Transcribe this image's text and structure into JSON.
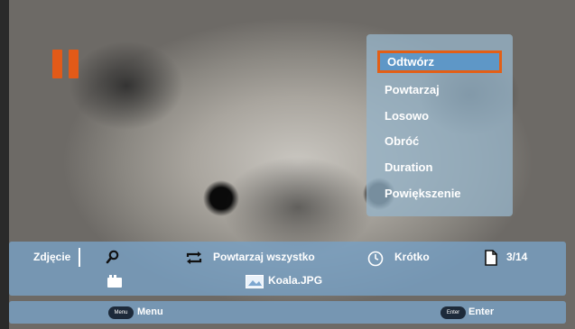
{
  "playback": {
    "state_icon": "pause-icon"
  },
  "menu": {
    "items": [
      {
        "label": "Odtwórz",
        "selected": true
      },
      {
        "label": "Powtarzaj",
        "selected": false
      },
      {
        "label": "Losowo",
        "selected": false
      },
      {
        "label": "Obróć",
        "selected": false
      },
      {
        "label": "Duration",
        "selected": false
      },
      {
        "label": "Powiększenie",
        "selected": false
      }
    ]
  },
  "info": {
    "category": "Zdjęcie",
    "repeat_label": "Powtarzaj wszystko",
    "duration_label": "Krótko",
    "page_counter": "3/14",
    "filename": "Koala.JPG"
  },
  "keys": {
    "menu_badge": "Menu",
    "menu_label": "Menu",
    "enter_badge": "Enter",
    "enter_label": "Enter"
  },
  "colors": {
    "accent": "#e35f16",
    "panel": "#78a0c3",
    "selected_bg": "#5e97c7"
  }
}
